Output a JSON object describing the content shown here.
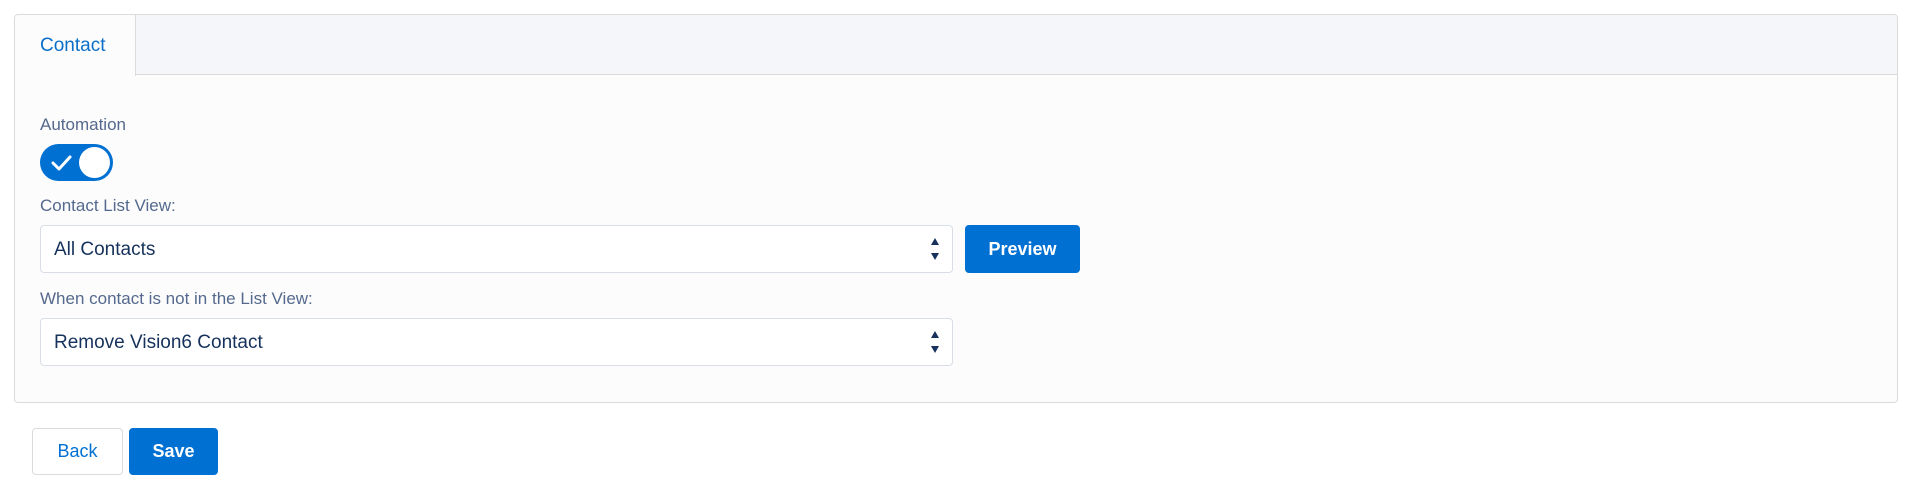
{
  "tabs": [
    {
      "label": "Contact",
      "active": true
    }
  ],
  "form": {
    "automation": {
      "label": "Automation",
      "enabled": true
    },
    "contact_list_view": {
      "label": "Contact List View:",
      "selected": "All Contacts",
      "preview_label": "Preview"
    },
    "not_in_list_view": {
      "label": "When contact is not in the List View:",
      "selected": "Remove Vision6 Contact"
    }
  },
  "footer": {
    "back_label": "Back",
    "save_label": "Save"
  },
  "colors": {
    "brand": "#0070d2",
    "label": "#54698d",
    "value_text": "#16325c",
    "border": "#dddbda"
  },
  "icons": {
    "toggle": "check-icon",
    "select": "sort-arrows-icon"
  }
}
